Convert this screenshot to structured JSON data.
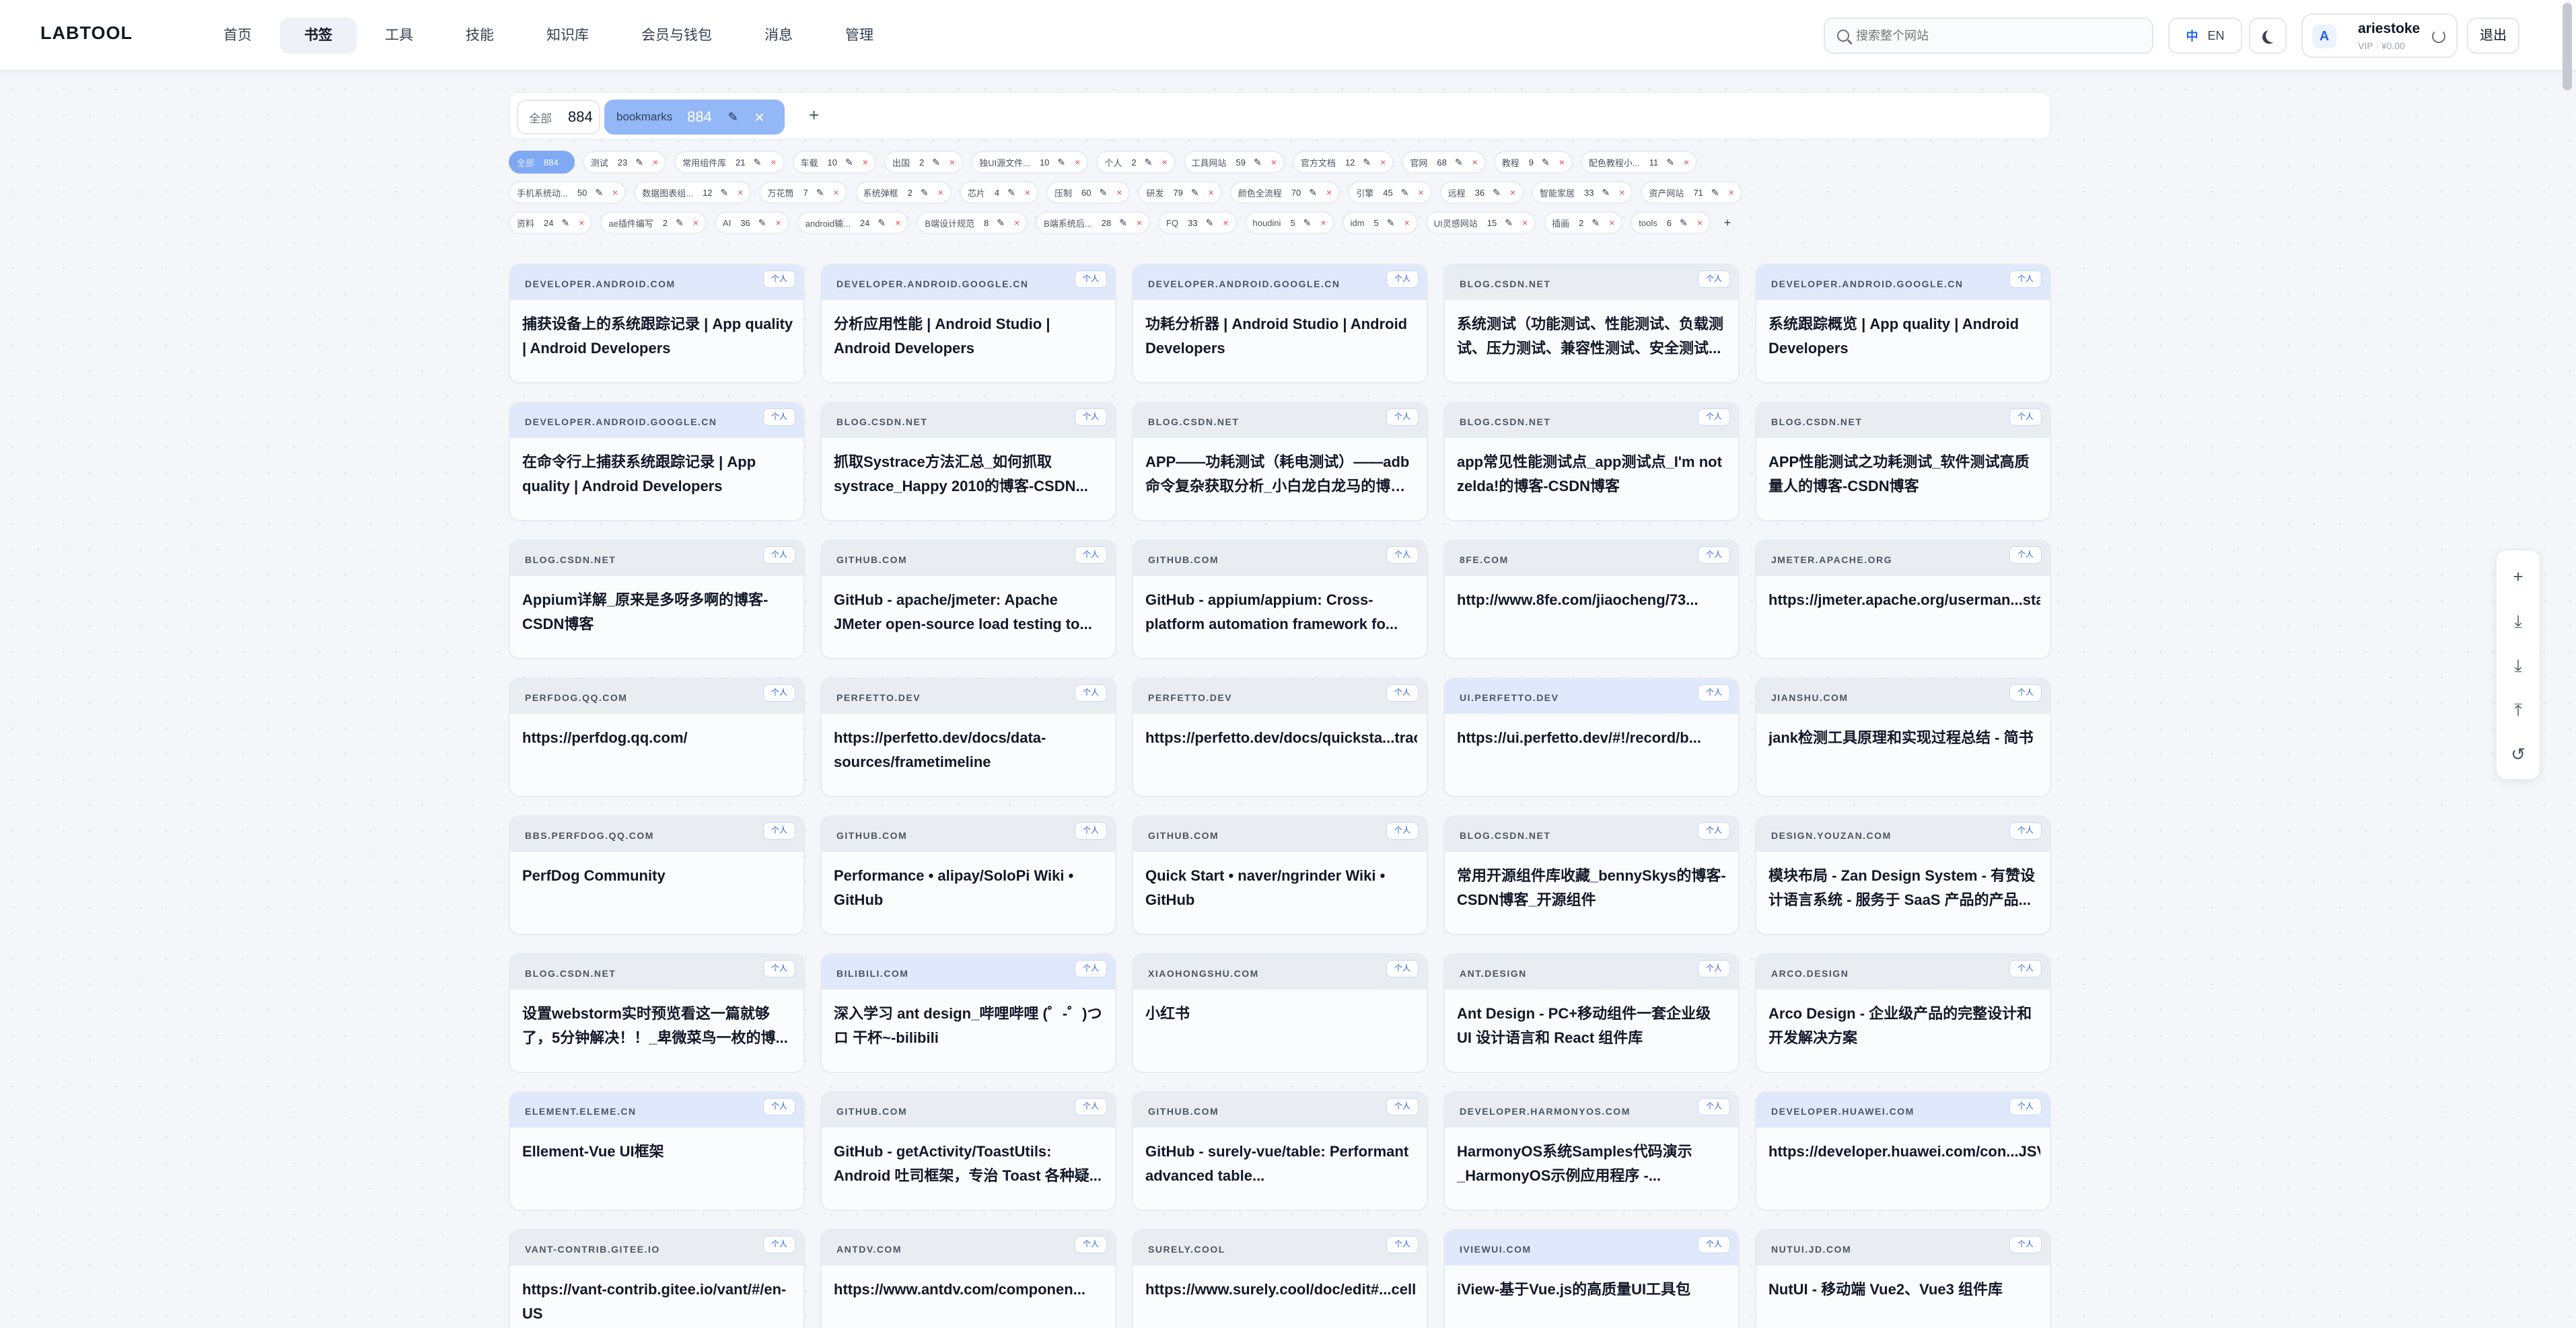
{
  "header": {
    "logo": "LABTOOL",
    "nav": [
      "首页",
      "书签",
      "工具",
      "技能",
      "知识库",
      "会员与钱包",
      "消息",
      "管理"
    ],
    "active_nav": 1,
    "search_placeholder": "搜索整个网站",
    "lang_zh": "中",
    "lang_en": "EN",
    "avatar_letter": "A",
    "username": "ariestoke",
    "user_sub": "VIP · ¥0.00",
    "logout": "退出"
  },
  "groups": {
    "all_label": "全部",
    "all_count": "884",
    "active_label": "bookmarks",
    "active_count": "884",
    "add": "+"
  },
  "tag_rows": [
    [
      {
        "name": "全部",
        "count": "884",
        "active": true
      },
      {
        "name": "测试",
        "count": "23"
      },
      {
        "name": "常用组件库",
        "count": "21"
      },
      {
        "name": "车载",
        "count": "10"
      },
      {
        "name": "出国",
        "count": "2"
      },
      {
        "name": "独UI源文件...",
        "count": "10"
      },
      {
        "name": "个人",
        "count": "2"
      },
      {
        "name": "工具网站",
        "count": "59"
      },
      {
        "name": "官方文档",
        "count": "12"
      },
      {
        "name": "官网",
        "count": "68"
      },
      {
        "name": "教程",
        "count": "9"
      },
      {
        "name": "配色教程小...",
        "count": "11"
      }
    ],
    [
      {
        "name": "手机系统动...",
        "count": "50"
      },
      {
        "name": "数据图表组...",
        "count": "12"
      },
      {
        "name": "万花筒",
        "count": "7"
      },
      {
        "name": "系统弹框",
        "count": "2"
      },
      {
        "name": "芯片",
        "count": "4"
      },
      {
        "name": "压制",
        "count": "60"
      },
      {
        "name": "研发",
        "count": "79"
      },
      {
        "name": "颜色全流程",
        "count": "70"
      },
      {
        "name": "引擎",
        "count": "45"
      },
      {
        "name": "远程",
        "count": "36"
      },
      {
        "name": "智能家居",
        "count": "33"
      },
      {
        "name": "资产网站",
        "count": "71"
      }
    ],
    [
      {
        "name": "资料",
        "count": "24"
      },
      {
        "name": "ae插件编写",
        "count": "2"
      },
      {
        "name": "AI",
        "count": "36"
      },
      {
        "name": "android输...",
        "count": "24"
      },
      {
        "name": "B端设计规范",
        "count": "8"
      },
      {
        "name": "B端系统后...",
        "count": "28"
      },
      {
        "name": "FQ",
        "count": "33"
      },
      {
        "name": "houdini",
        "count": "5"
      },
      {
        "name": "idm",
        "count": "5"
      },
      {
        "name": "UI灵感网站",
        "count": "15"
      },
      {
        "name": "插画",
        "count": "2"
      },
      {
        "name": "tools",
        "count": "6"
      }
    ]
  ],
  "tag_edit_icon": "✎",
  "tag_delete_icon": "×",
  "badge_label": "个人",
  "cards": [
    {
      "domain": "DEVELOPER.ANDROID.COM",
      "title": "捕获设备上的系统跟踪记录 | App quality | Android Developers",
      "color": "blue"
    },
    {
      "domain": "DEVELOPER.ANDROID.GOOGLE.CN",
      "title": "分析应用性能 | Android Studio | Android Developers",
      "color": "blue"
    },
    {
      "domain": "DEVELOPER.ANDROID.GOOGLE.CN",
      "title": "功耗分析器 | Android Studio | Android Developers",
      "color": "blue"
    },
    {
      "domain": "BLOG.CSDN.NET",
      "title": "系统测试（功能测试、性能测试、负载测试、压力测试、兼容性测试、安全测试...",
      "color": "gray"
    },
    {
      "domain": "DEVELOPER.ANDROID.GOOGLE.CN",
      "title": "系统跟踪概览 | App quality | Android Developers",
      "color": "blue"
    },
    {
      "domain": "DEVELOPER.ANDROID.GOOGLE.CN",
      "title": "在命令行上捕获系统跟踪记录 | App quality | Android Developers",
      "color": "blue"
    },
    {
      "domain": "BLOG.CSDN.NET",
      "title": "抓取Systrace方法汇总_如何抓取systrace_Happy 2010的博客-CSDN...",
      "color": "gray"
    },
    {
      "domain": "BLOG.CSDN.NET",
      "title": "APP——功耗测试（耗电测试）——adb命令复杂获取分析_小白龙白龙马的博客...",
      "color": "gray"
    },
    {
      "domain": "BLOG.CSDN.NET",
      "title": "app常见性能测试点_app测试点_I'm not zelda!的博客-CSDN博客",
      "color": "gray"
    },
    {
      "domain": "BLOG.CSDN.NET",
      "title": "APP性能测试之功耗测试_软件测试高质量人的博客-CSDN博客",
      "color": "gray"
    },
    {
      "domain": "BLOG.CSDN.NET",
      "title": "Appium详解_原来是多呀多啊的博客-CSDN博客",
      "color": "gray"
    },
    {
      "domain": "GITHUB.COM",
      "title": "GitHub - apache/jmeter: Apache JMeter open-source load testing to...",
      "color": "gray"
    },
    {
      "domain": "GITHUB.COM",
      "title": "GitHub - appium/appium: Cross-platform automation framework fo...",
      "color": "gray"
    },
    {
      "domain": "8FE.COM",
      "title": "http://www.8fe.com/jiaocheng/73...",
      "color": "gray"
    },
    {
      "domain": "JMETER.APACHE.ORG",
      "title": "https://jmeter.apache.org/userman...started.html",
      "color": "gray"
    },
    {
      "domain": "PERFDOG.QQ.COM",
      "title": "https://perfdog.qq.com/",
      "color": "gray"
    },
    {
      "domain": "PERFETTO.DEV",
      "title": "https://perfetto.dev/docs/data-sources/frametimeline",
      "color": "gray"
    },
    {
      "domain": "PERFETTO.DEV",
      "title": "https://perfetto.dev/docs/quicksta...tracing",
      "color": "gray"
    },
    {
      "domain": "UI.PERFETTO.DEV",
      "title": "https://ui.perfetto.dev/#!/record/b...",
      "color": "blue"
    },
    {
      "domain": "JIANSHU.COM",
      "title": "jank检测工具原理和实现过程总结 - 简书",
      "color": "gray"
    },
    {
      "domain": "BBS.PERFDOG.QQ.COM",
      "title": "PerfDog Community",
      "color": "gray"
    },
    {
      "domain": "GITHUB.COM",
      "title": "Performance • alipay/SoloPi Wiki • GitHub",
      "color": "gray"
    },
    {
      "domain": "GITHUB.COM",
      "title": "Quick Start • naver/ngrinder Wiki • GitHub",
      "color": "gray"
    },
    {
      "domain": "BLOG.CSDN.NET",
      "title": "常用开源组件库收藏_bennySkys的博客-CSDN博客_开源组件",
      "color": "gray"
    },
    {
      "domain": "DESIGN.YOUZAN.COM",
      "title": "模块布局 - Zan Design System - 有赞设计语言系统 - 服务于 SaaS 产品的产品...",
      "color": "gray"
    },
    {
      "domain": "BLOG.CSDN.NET",
      "title": "设置webstorm实时预览看这一篇就够了，5分钟解决！！_卑微菜鸟一枚的博...",
      "color": "gray"
    },
    {
      "domain": "BILIBILI.COM",
      "title": "深入学习 ant design_哔哩哔哩 (゜-゜)つロ 干杯~-bilibili",
      "color": "blue"
    },
    {
      "domain": "XIAOHONGSHU.COM",
      "title": "小红书",
      "color": "gray"
    },
    {
      "domain": "ANT.DESIGN",
      "title": "Ant Design - PC+移动组件一套企业级 UI 设计语言和 React 组件库",
      "color": "gray"
    },
    {
      "domain": "ARCO.DESIGN",
      "title": "Arco Design - 企业级产品的完整设计和开发解决方案",
      "color": "gray"
    },
    {
      "domain": "ELEMENT.ELEME.CN",
      "title": "Ellement-Vue UI框架",
      "color": "blue"
    },
    {
      "domain": "GITHUB.COM",
      "title": "GitHub - getActivity/ToastUtils: Android 吐司框架，专治 Toast 各种疑...",
      "color": "gray"
    },
    {
      "domain": "GITHUB.COM",
      "title": "GitHub - surely-vue/table: Performant advanced table...",
      "color": "gray"
    },
    {
      "domain": "DEVELOPER.HARMONYOS.COM",
      "title": "HarmonyOS系统Samples代码演示_HarmonyOS示例应用程序 -...",
      "color": "gray"
    },
    {
      "domain": "DEVELOPER.HUAWEI.COM",
      "title": "https://developer.huawei.com/con...JSVideoPlayer",
      "color": "blue"
    },
    {
      "domain": "VANT-CONTRIB.GITEE.IO",
      "title": "https://vant-contrib.gitee.io/vant/#/en-US",
      "color": "gray"
    },
    {
      "domain": "ANTDV.COM",
      "title": "https://www.antdv.com/componen...",
      "color": "gray"
    },
    {
      "domain": "SURELY.COOL",
      "title": "https://www.surely.cool/doc/edit#...cell",
      "color": "gray"
    },
    {
      "domain": "IVIEWUI.COM",
      "title": "iView-基于Vue.js的高质量UI工具包",
      "color": "blue"
    },
    {
      "domain": "NUTUI.JD.COM",
      "title": "NutUI - 移动端 Vue2、Vue3 组件库",
      "color": "gray"
    }
  ],
  "float_tools": [
    {
      "name": "add-icon",
      "glyph": "+"
    },
    {
      "name": "import-icon",
      "glyph": "⤓"
    },
    {
      "name": "download-icon",
      "glyph": "⤓"
    },
    {
      "name": "scroll-top-icon",
      "glyph": "⤒"
    },
    {
      "name": "reset-icon",
      "glyph": "↺"
    }
  ]
}
